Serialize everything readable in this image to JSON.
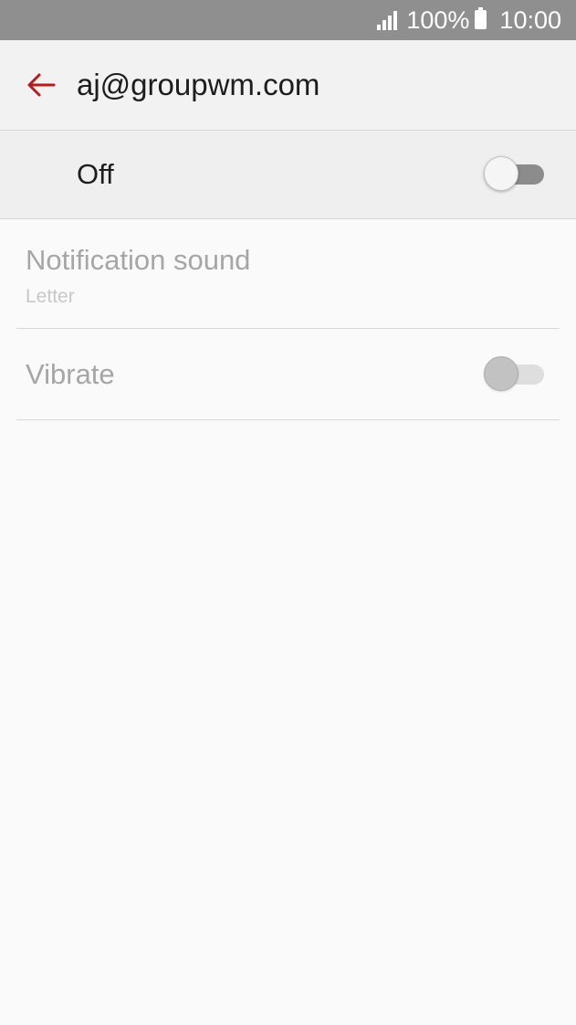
{
  "status_bar": {
    "battery": "100%",
    "time": "10:00"
  },
  "app_bar": {
    "title": "aj@groupwm.com",
    "accent_color": "#b71c1c"
  },
  "master_switch": {
    "label": "Off",
    "checked": false
  },
  "settings": {
    "notification_sound": {
      "title": "Notification sound",
      "summary": "Letter"
    },
    "vibrate": {
      "title": "Vibrate",
      "checked": false,
      "enabled": false
    }
  }
}
